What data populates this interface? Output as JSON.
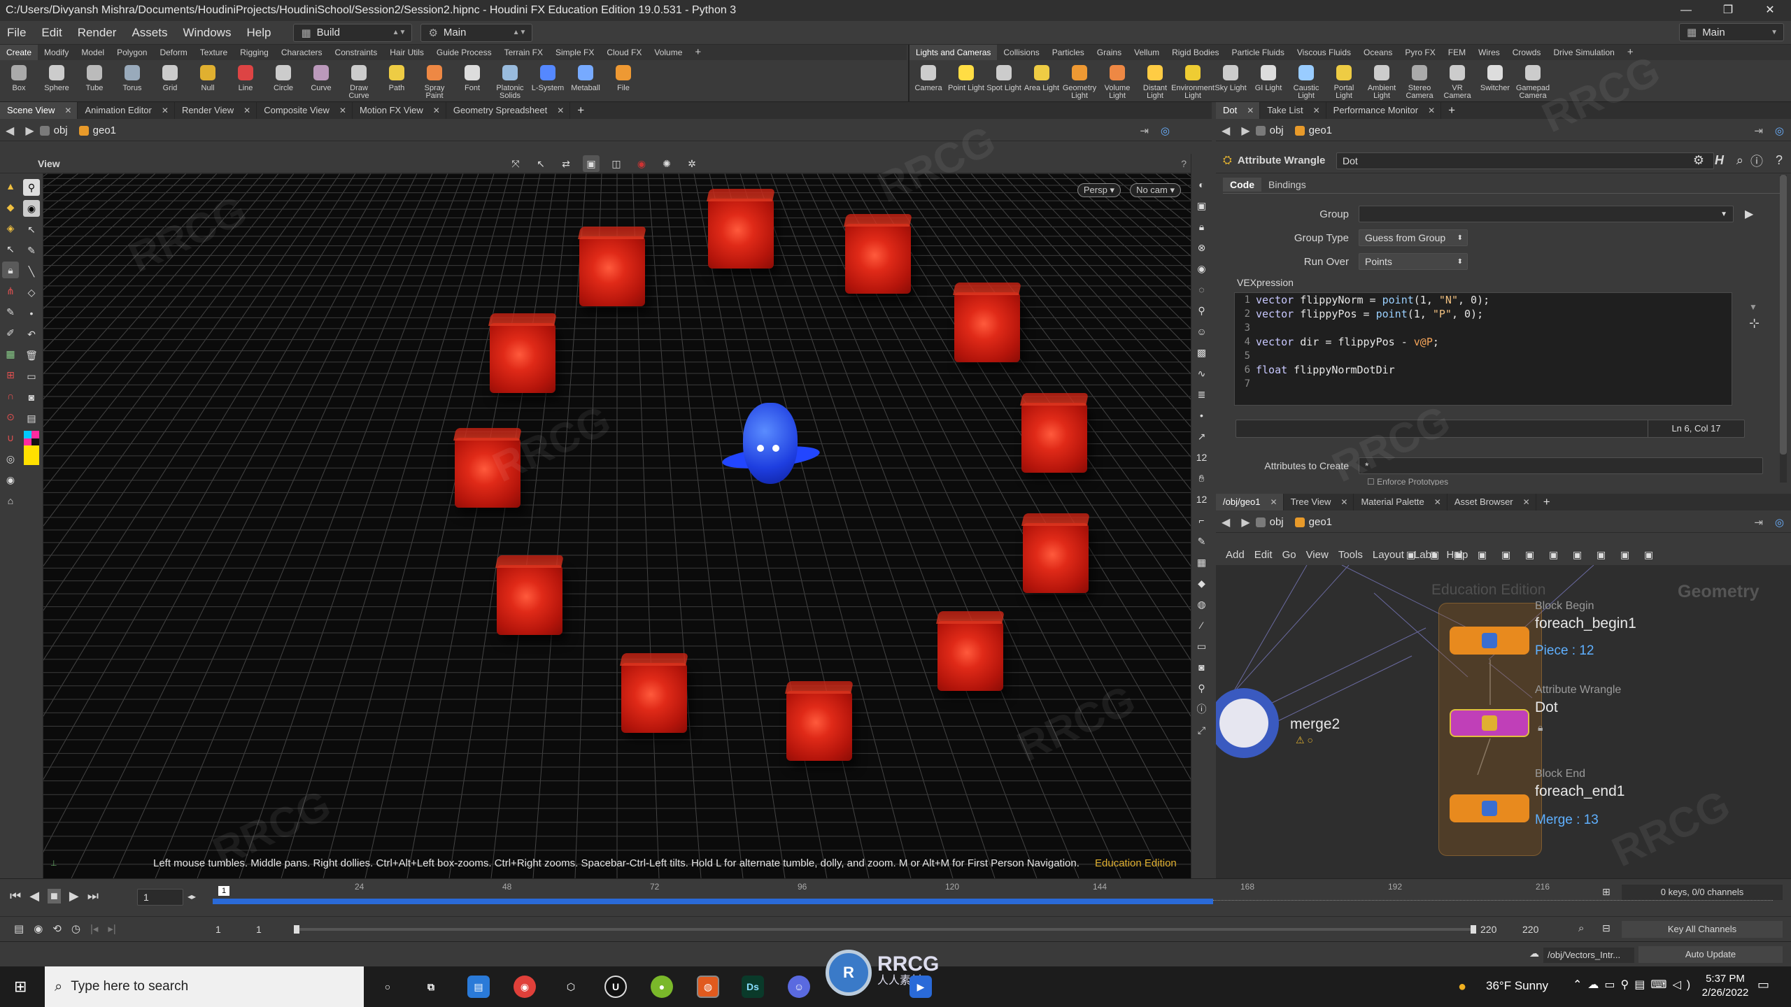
{
  "window": {
    "title": "C:/Users/Divyansh Mishra/Documents/HoudiniProjects/HoudiniSchool/Session2/Session2.hipnc - Houdini FX Education Edition 19.0.531 - Python 3"
  },
  "menubar": {
    "items": [
      "File",
      "Edit",
      "Render",
      "Assets",
      "Windows",
      "Help"
    ],
    "desktop": "Build",
    "main": "Main",
    "main_right": "Main"
  },
  "shelf": {
    "left_tabs": [
      "Create",
      "Modify",
      "Model",
      "Polygon",
      "Deform",
      "Texture",
      "Rigging",
      "Characters",
      "Constraints",
      "Hair Utils",
      "Guide Process",
      "Terrain FX",
      "Simple FX",
      "Cloud FX",
      "Volume"
    ],
    "right_tabs": [
      "Lights and Cameras",
      "Collisions",
      "Particles",
      "Grains",
      "Vellum",
      "Rigid Bodies",
      "Particle Fluids",
      "Viscous Fluids",
      "Oceans",
      "Pyro FX",
      "FEM",
      "Wires",
      "Crowds",
      "Drive Simulation"
    ],
    "left_tools": [
      "Box",
      "Sphere",
      "Tube",
      "Torus",
      "Grid",
      "Null",
      "Line",
      "Circle",
      "Curve",
      "Draw Curve",
      "Path",
      "Spray Paint",
      "Font",
      "Platonic Solids",
      "L-System",
      "Metaball",
      "File"
    ],
    "right_tools": [
      "Camera",
      "Point Light",
      "Spot Light",
      "Area Light",
      "Geometry Light",
      "Volume Light",
      "Distant Light",
      "Environment Light",
      "Sky Light",
      "GI Light",
      "Caustic Light",
      "Portal Light",
      "Ambient Light",
      "Stereo Camera",
      "VR Camera",
      "Switcher",
      "Gamepad Camera"
    ]
  },
  "left_panetabs": [
    "Scene View",
    "Animation Editor",
    "Render View",
    "Composite View",
    "Motion FX View",
    "Geometry Spreadsheet"
  ],
  "right_panetabs": [
    "Dot",
    "Take List",
    "Performance Monitor"
  ],
  "path": {
    "obj": "obj",
    "geo": "geo1"
  },
  "viewport": {
    "label": "View",
    "persp": "Persp",
    "cam": "No cam",
    "hint": "Left mouse tumbles. Middle pans. Right dollies. Ctrl+Alt+Left box-zooms. Ctrl+Right zooms. Spacebar-Ctrl-Left tilts. Hold L for alternate tumble, dolly, and zoom.    M or Alt+M for First Person Navigation.",
    "edu": "Education Edition"
  },
  "parm": {
    "node_type": "Attribute Wrangle",
    "node_name": "Dot",
    "tabs": [
      "Code",
      "Bindings"
    ],
    "group_label": "Group",
    "group_type_label": "Group Type",
    "group_type_value": "Guess from Group",
    "run_over_label": "Run Over",
    "run_over_value": "Points",
    "vex_label": "VEXpression",
    "cursor": "Ln 6, Col 17",
    "attrs_label": "Attributes to Create",
    "attrs_value": "*",
    "enforce": "Enforce Prototypes"
  },
  "code": {
    "lines": [
      {
        "n": "1",
        "t": "vector flippyNorm = point(1, \"N\", 0);"
      },
      {
        "n": "2",
        "t": "vector flippyPos = point(1, \"P\", 0);"
      },
      {
        "n": "3",
        "t": ""
      },
      {
        "n": "4",
        "t": "vector dir = flippyPos - v@P;"
      },
      {
        "n": "5",
        "t": ""
      },
      {
        "n": "6",
        "t": "float flippyNormDotDir"
      },
      {
        "n": "7",
        "t": ""
      }
    ]
  },
  "network_tabs": [
    "/obj/geo1",
    "Tree View",
    "Material Palette",
    "Asset Browser"
  ],
  "network_menu": [
    "Add",
    "Edit",
    "Go",
    "View",
    "Tools",
    "Layout",
    "Labs",
    "Help"
  ],
  "network": {
    "watermark_edu": "Education Edition",
    "watermark_ctx": "Geometry",
    "block_begin_label": "Block Begin",
    "block_begin_name": "foreach_begin1",
    "piece": "Piece : 12",
    "wrangle_label": "Attribute Wrangle",
    "wrangle_name": "Dot",
    "block_end_label": "Block End",
    "block_end_name": "foreach_end1",
    "merge": "Merge : 13",
    "merge_node": "merge2"
  },
  "timeline": {
    "ticks": [
      "24",
      "48",
      "72",
      "96",
      "120",
      "144",
      "168",
      "192",
      "216"
    ],
    "current_frame": "1",
    "marker": "1",
    "range_start": "1",
    "range_start2": "1",
    "range_end": "220",
    "range_end2": "220",
    "keys": "0 keys, 0/0 channels",
    "key_all": "Key All Channels",
    "playhead_fraction": 0.0
  },
  "status": {
    "path": "/obj/Vectors_Intr...",
    "update": "Auto Update"
  },
  "taskbar": {
    "search_placeholder": "Type here to search",
    "weather": "36°F  Sunny",
    "time": "5:37 PM",
    "date": "2/26/2022"
  },
  "watermark": {
    "logo": "RRCG",
    "sub": "人人素材"
  }
}
